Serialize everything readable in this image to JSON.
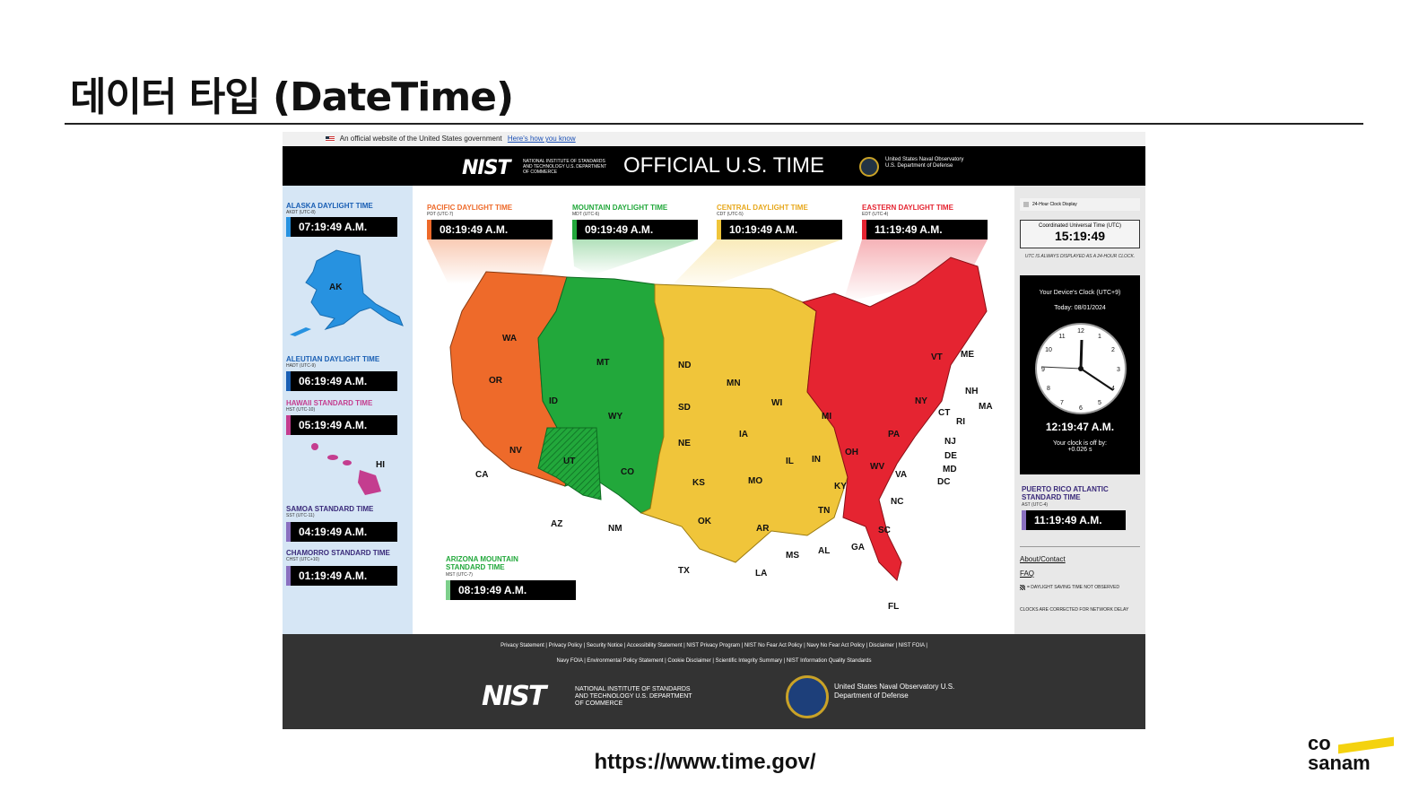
{
  "slide": {
    "title": "데이터 타입 (DateTime)",
    "source_url": "https://www.time.gov/",
    "brand_top": "co",
    "brand_bottom": "sanam"
  },
  "colors": {
    "pacific": "#ee6a2a",
    "mountain": "#22a83b",
    "central": "#f0c53a",
    "eastern": "#e52431",
    "alaska": "#2792e0",
    "hawaii": "#c43d8f"
  },
  "site": {
    "gov_banner": "An official website of the United States government",
    "gov_banner_link": "Here's how you know",
    "nist_logo": "NIST",
    "nist_subtitle": "NATIONAL INSTITUTE OF STANDARDS AND TECHNOLOGY U.S. DEPARTMENT OF COMMERCE",
    "title": "OFFICIAL U.S. TIME",
    "navy_name": "United States Naval Observatory U.S. Department of Defense"
  },
  "left_zones": [
    {
      "name": "ALASKA DAYLIGHT TIME",
      "abbr": "AKDT (UTC-8)",
      "time": "07:19:49 A.M."
    },
    {
      "name": "ALEUTIAN DAYLIGHT TIME",
      "abbr": "HADT (UTC-9)",
      "time": "06:19:49 A.M."
    },
    {
      "name": "HAWAII STANDARD TIME",
      "abbr": "HST (UTC-10)",
      "time": "05:19:49 A.M."
    },
    {
      "name": "SAMOA STANDARD TIME",
      "abbr": "SST (UTC-11)",
      "time": "04:19:49 A.M."
    },
    {
      "name": "CHAMORRO STANDARD TIME",
      "abbr": "CHST (UTC+10)",
      "time": "01:19:49 A.M."
    }
  ],
  "map_zones": [
    {
      "name": "PACIFIC DAYLIGHT TIME",
      "abbr": "PDT (UTC-7)",
      "time": "08:19:49 A.M."
    },
    {
      "name": "MOUNTAIN DAYLIGHT TIME",
      "abbr": "MDT (UTC-6)",
      "time": "09:19:49 A.M."
    },
    {
      "name": "CENTRAL DAYLIGHT TIME",
      "abbr": "CDT (UTC-5)",
      "time": "10:19:49 A.M."
    },
    {
      "name": "EASTERN DAYLIGHT TIME",
      "abbr": "EDT (UTC-4)",
      "time": "11:19:49 A.M."
    },
    {
      "name": "ARIZONA MOUNTAIN STANDARD TIME",
      "abbr": "MST (UTC-7)",
      "time": "08:19:49 A.M."
    }
  ],
  "states": [
    "AK",
    "HI",
    "WA",
    "OR",
    "CA",
    "NV",
    "ID",
    "MT",
    "WY",
    "UT",
    "CO",
    "AZ",
    "NM",
    "ND",
    "SD",
    "NE",
    "KS",
    "OK",
    "TX",
    "MN",
    "IA",
    "MO",
    "AR",
    "LA",
    "WI",
    "IL",
    "MS",
    "AL",
    "TN",
    "KY",
    "IN",
    "MI",
    "OH",
    "WV",
    "VA",
    "NC",
    "SC",
    "GA",
    "FL",
    "PA",
    "NY",
    "VT",
    "ME",
    "NH",
    "MA",
    "CT",
    "RI",
    "NJ",
    "DE",
    "MD",
    "DC"
  ],
  "right": {
    "toggle_label": "24-Hour Clock Display",
    "utc_caption": "Coordinated Universal Time (UTC)",
    "utc_time": "15:19:49",
    "utc_note": "UTC IS ALWAYS DISPLAYED AS A 24-HOUR CLOCK.",
    "device_title": "Your Device's Clock (UTC+9)",
    "device_date": "Today: 08/01/2024",
    "device_time": "12:19:47 A.M.",
    "device_offset_label": "Your clock is off by:",
    "device_offset": "+0.026 s",
    "pr_name": "PUERTO RICO ATLANTIC STANDARD TIME",
    "pr_abbr": "AST (UTC-4)",
    "pr_time": "11:19:49 A.M.",
    "link_about": "About/Contact",
    "link_faq": "FAQ",
    "note_dst": "= DAYLIGHT SAVING TIME NOT OBSERVED",
    "note_network": "CLOCKS ARE CORRECTED FOR NETWORK DELAY"
  },
  "footer": {
    "links_row1": "Privacy Statement  |  Privacy Policy  |  Security Notice  |  Accessibility Statement  |  NIST Privacy Program  |  NIST No Fear Act Policy  |  Navy No Fear Act Policy  |  Disclaimer  |  NIST FOIA  |",
    "links_row2": "Navy FOIA  |  Environmental Policy Statement  |  Cookie Disclaimer  |  Scientific Integrity Summary  |  NIST Information Quality Standards",
    "nist_logo": "NIST",
    "nist_subtitle": "NATIONAL INSTITUTE OF STANDARDS AND TECHNOLOGY U.S. DEPARTMENT OF COMMERCE",
    "navy_name": "United States Naval Observatory U.S. Department of Defense"
  }
}
